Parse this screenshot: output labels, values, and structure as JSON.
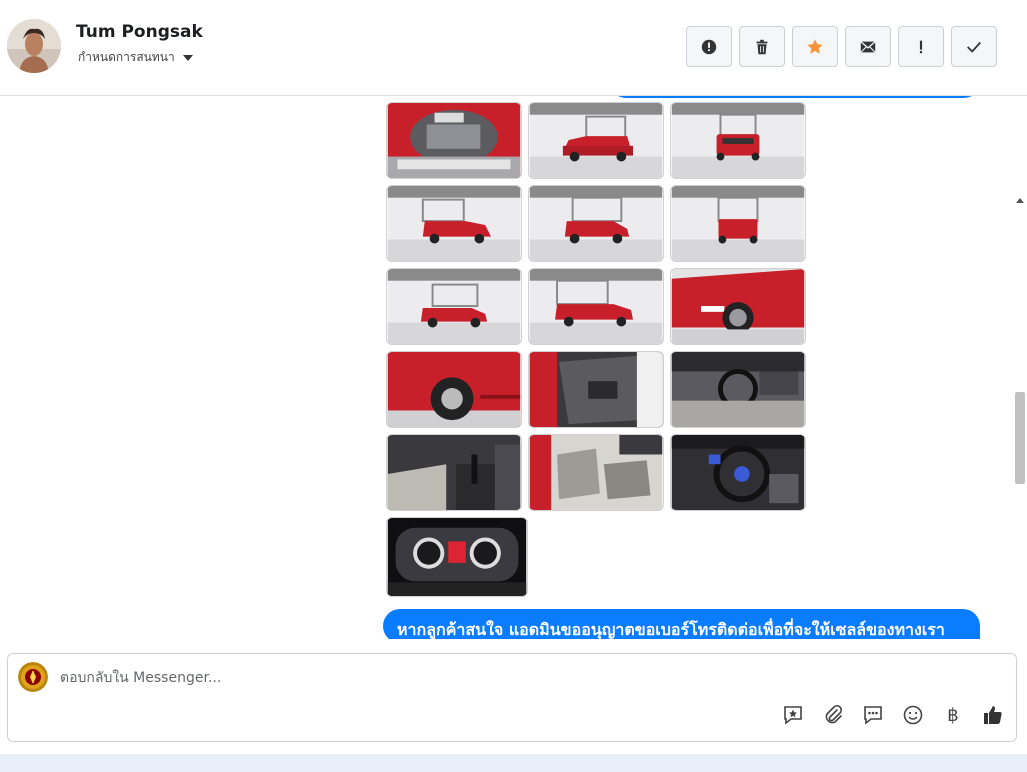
{
  "header": {
    "contact_name": "Tum Pongsak",
    "subtitle": "กำหนดการสนทนา",
    "actions": [
      {
        "name": "spam-button",
        "icon": "alert-circle-icon"
      },
      {
        "name": "delete-button",
        "icon": "trash-icon"
      },
      {
        "name": "star-button",
        "icon": "star-icon"
      },
      {
        "name": "mark-unread-button",
        "icon": "envelope-icon"
      },
      {
        "name": "follow-up-button",
        "icon": "exclamation-icon"
      },
      {
        "name": "mark-done-button",
        "icon": "checkmark-icon"
      }
    ]
  },
  "thread": {
    "photo_count": 16,
    "message_text": "หากลูกค้าสนใจ แอดมินขออนุญาตขอเบอร์โทรติดต่อเพื่อที่จะให้เซลล์ของทางเรา"
  },
  "composer": {
    "placeholder": "ตอบกลับใน Messenger...",
    "tools": [
      {
        "name": "saved-replies-button",
        "icon": "star-bubble-icon"
      },
      {
        "name": "attach-button",
        "icon": "paperclip-icon"
      },
      {
        "name": "quick-replies-button",
        "icon": "chat-dots-icon"
      },
      {
        "name": "emoji-button",
        "icon": "smiley-icon"
      },
      {
        "name": "payment-button",
        "icon": "baht-icon"
      },
      {
        "name": "like-button",
        "icon": "thumbs-up-icon"
      }
    ],
    "baht_symbol": "฿"
  },
  "colors": {
    "accent": "#0a7cff",
    "star": "#f7923a",
    "car_red": "#c8202a"
  }
}
